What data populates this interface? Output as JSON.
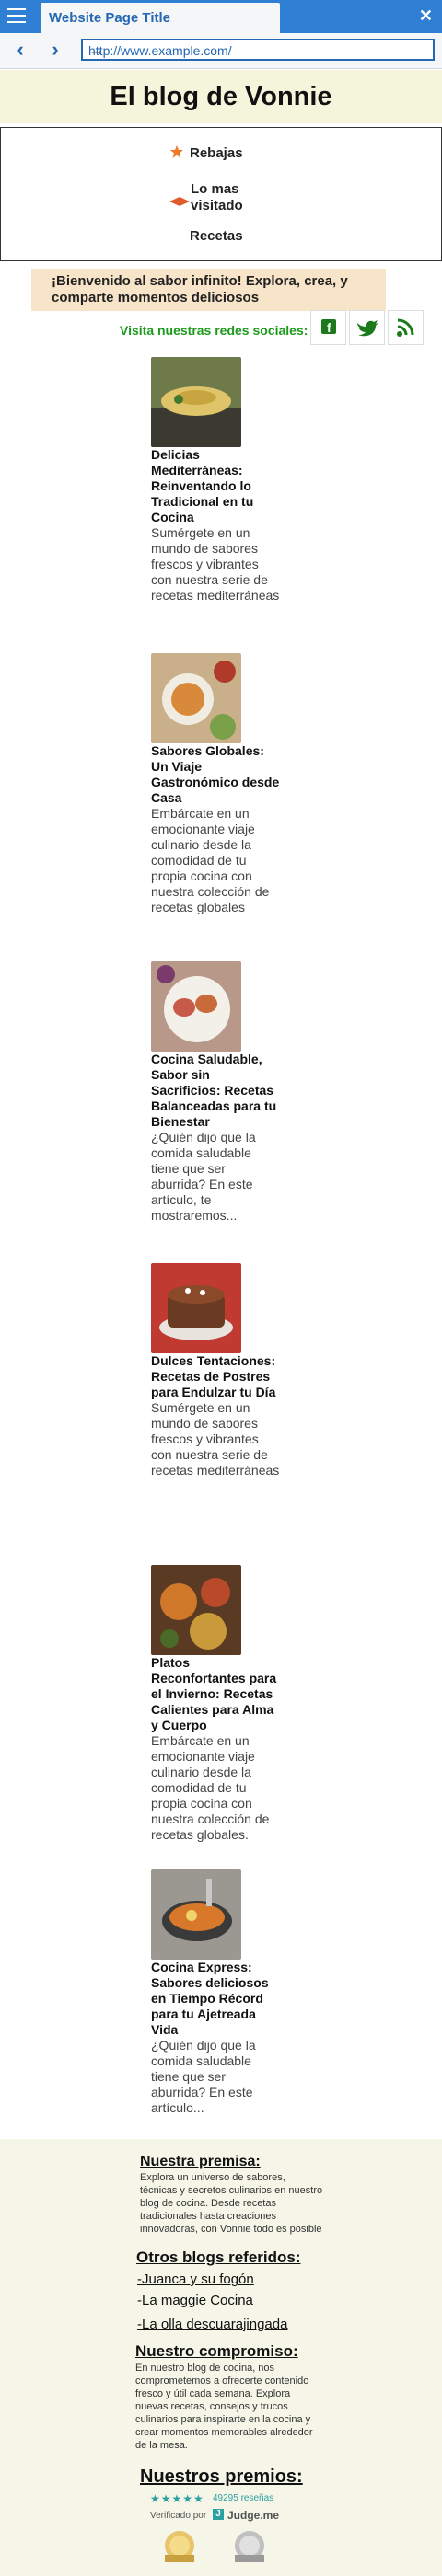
{
  "browser": {
    "tab_title": "Website Page Title",
    "url": "http://www.example.com/"
  },
  "site": {
    "title": "El blog de Vonnie",
    "menu": [
      {
        "label": "Rebajas",
        "icon": "star-icon"
      },
      {
        "label": "Lo mas visitado",
        "icon": "diamond-icon"
      },
      {
        "label": "Recetas",
        "icon": "none"
      }
    ],
    "welcome": "¡Bienvenido al sabor infinito!  Explora, crea, y comparte momentos deliciosos",
    "social_label": "Visita nuestras redes sociales:",
    "social": [
      {
        "name": "facebook-icon",
        "color": "#1c7a1c"
      },
      {
        "name": "twitter-icon",
        "color": "#1c7a1c"
      },
      {
        "name": "rss-icon",
        "color": "#1c7a1c"
      }
    ]
  },
  "posts": [
    {
      "title": "Delicias Mediterráneas: Reinventando lo Tradicional en tu Cocina",
      "excerpt": "Sumérgete en un mundo de sabores frescos y vibrantes con nuestra serie de recetas mediterráneas"
    },
    {
      "title": "Sabores Globales: Un Viaje Gastronómico desde Casa",
      "excerpt": "Embárcate en un emocionante viaje culinario desde la comodidad de tu propia cocina con nuestra colección de recetas globales"
    },
    {
      "title": "Cocina Saludable, Sabor sin Sacrificios: Recetas Balanceadas para tu Bienestar",
      "excerpt": "¿Quién dijo que la comida saludable tiene que ser aburrida? En este artículo, te mostraremos..."
    },
    {
      "title": "Dulces Tentaciones: Recetas de Postres para Endulzar tu Día",
      "excerpt": "Sumérgete en un mundo de sabores frescos y vibrantes con nuestra serie de recetas mediterráneas"
    },
    {
      "title": "Platos Reconfortantes para el Invierno: Recetas Calientes para Alma y Cuerpo",
      "excerpt": "Embárcate en un emocionante viaje culinario desde la comodidad de tu propia cocina con nuestra colección de recetas globales."
    },
    {
      "title": "Cocina Express: Sabores deliciosos en Tiempo Récord para tu Ajetreada Vida",
      "excerpt": "¿Quién dijo que la comida saludable tiene que ser aburrida? En este artículo..."
    }
  ],
  "footer": {
    "premise_title": "Nuestra premisa:",
    "premise_text": "Explora un universo de sabores, técnicas y secretos culinarios en nuestro blog de cocina. Desde recetas tradicionales hasta creaciones innovadoras, con Vonnie todo es posible",
    "blogs_title": "Otros blogs referidos:",
    "blogs": [
      "-Juanca y su fogón",
      "-La maggie Cocina",
      "-La olla descuarajingada"
    ],
    "commitment_title": "Nuestro compromiso:",
    "commitment_text": "En nuestro blog de cocina, nos comprometemos a ofrecerte contenido fresco y útil cada semana. Explora nuevas recetas, consejos y trucos culinarios para inspirarte en la cocina y crear momentos memorables alrededor de la mesa.",
    "awards_title": "Nuestros premios:",
    "reviews_count": "49295 reseñas",
    "verified_by": "Verificado por",
    "judge_brand": "Judge.me"
  }
}
